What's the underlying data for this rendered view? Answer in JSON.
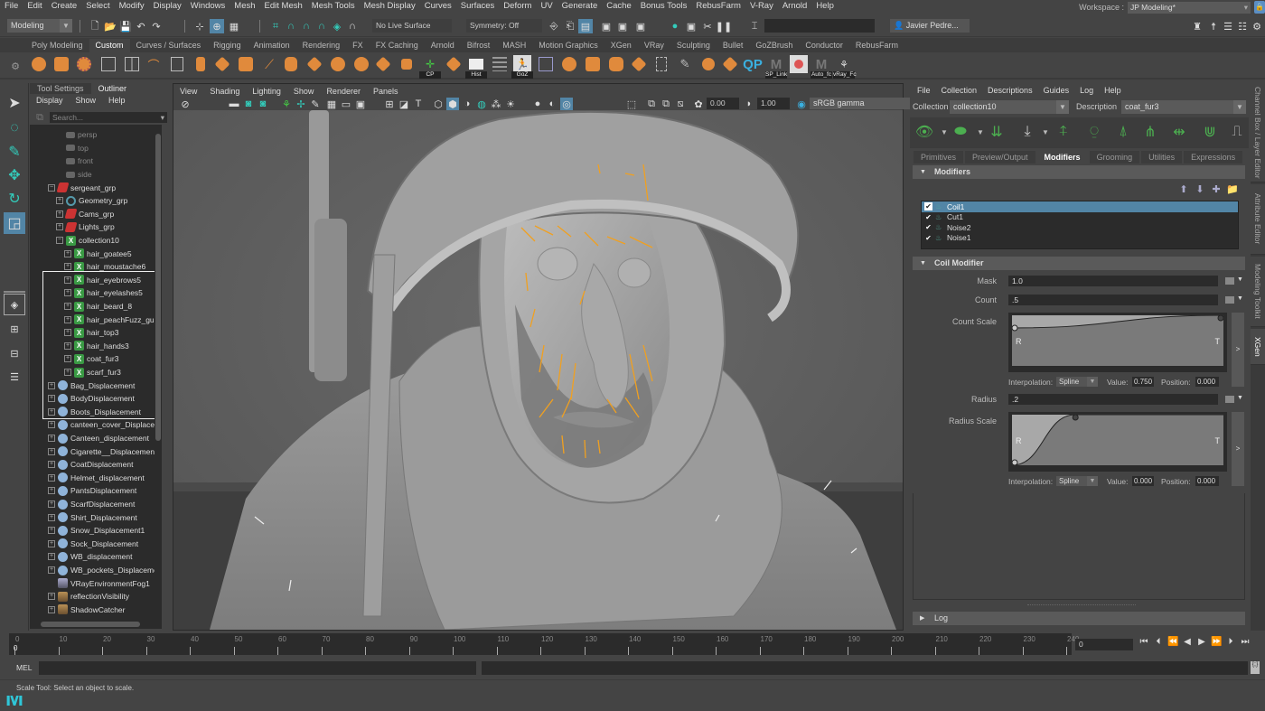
{
  "menubar": {
    "items": [
      "File",
      "Edit",
      "Create",
      "Select",
      "Modify",
      "Display",
      "Windows",
      "Mesh",
      "Edit Mesh",
      "Mesh Tools",
      "Mesh Display",
      "Curves",
      "Surfaces",
      "Deform",
      "UV",
      "Generate",
      "Cache",
      "Bonus Tools",
      "RebusFarm",
      "V-Ray",
      "Arnold",
      "Help"
    ],
    "workspace_label": "Workspace :",
    "workspace_value": "JP Modeling*"
  },
  "statusline": {
    "menuset": "Modeling",
    "live_surface": "No Live Surface",
    "symmetry": "Symmetry: Off",
    "user": "Javier Pedre..."
  },
  "shelf": {
    "tabs": [
      "Poly Modeling",
      "Custom",
      "Curves / Surfaces",
      "Rigging",
      "Animation",
      "Rendering",
      "FX",
      "FX Caching",
      "Arnold",
      "Bifrost",
      "MASH",
      "Motion Graphics",
      "XGen",
      "VRay",
      "Sculpting",
      "Bullet",
      "GoZBrush",
      "Conductor",
      "RebusFarm"
    ],
    "active_tab": "Custom",
    "labels": {
      "cp": "CP",
      "hist": "Hist",
      "goz": "GoZ",
      "qp": "QP",
      "sp_link": "SP_Link",
      "auto_fc": "Auto_fc",
      "vray_fc": "vRay_Fc"
    }
  },
  "outliner": {
    "tabs": [
      "Tool Settings",
      "Outliner"
    ],
    "active_tab": "Outliner",
    "menu": [
      "Display",
      "Show",
      "Help"
    ],
    "search_placeholder": "Search...",
    "rows": [
      {
        "label": "persp",
        "indent": 0,
        "icon": "cam",
        "dim": true
      },
      {
        "label": "top",
        "indent": 0,
        "icon": "cam",
        "dim": true
      },
      {
        "label": "front",
        "indent": 0,
        "icon": "cam",
        "dim": true
      },
      {
        "label": "side",
        "indent": 0,
        "icon": "cam",
        "dim": true
      },
      {
        "label": "sergeant_grp",
        "indent": 0,
        "icon": "grp",
        "exp": "−"
      },
      {
        "label": "Geometry_grp",
        "indent": 1,
        "icon": "geo",
        "exp": "+"
      },
      {
        "label": "Cams_grp",
        "indent": 1,
        "icon": "grp",
        "exp": "+"
      },
      {
        "label": "Lights_grp",
        "indent": 1,
        "icon": "grp",
        "exp": "+"
      },
      {
        "label": "collection10",
        "indent": 1,
        "icon": "xg",
        "exp": "−"
      },
      {
        "label": "hair_goatee5",
        "indent": 2,
        "icon": "xg",
        "exp": "+"
      },
      {
        "label": "hair_moustache6",
        "indent": 2,
        "icon": "xg",
        "exp": "+"
      },
      {
        "label": "hair_eyebrows5",
        "indent": 2,
        "icon": "xg",
        "exp": "+"
      },
      {
        "label": "hair_eyelashes5",
        "indent": 2,
        "icon": "xg",
        "exp": "+"
      },
      {
        "label": "hair_beard_8",
        "indent": 2,
        "icon": "xg",
        "exp": "+"
      },
      {
        "label": "hair_peachFuzz_guide",
        "indent": 2,
        "icon": "xg",
        "exp": "+"
      },
      {
        "label": "hair_top3",
        "indent": 2,
        "icon": "xg",
        "exp": "+"
      },
      {
        "label": "hair_hands3",
        "indent": 2,
        "icon": "xg",
        "exp": "+"
      },
      {
        "label": "coat_fur3",
        "indent": 2,
        "icon": "xg",
        "exp": "+"
      },
      {
        "label": "scarf_fur3",
        "indent": 2,
        "icon": "xg",
        "exp": "+"
      },
      {
        "label": "Bag_Displacement",
        "indent": 0,
        "icon": "disp",
        "exp": "+"
      },
      {
        "label": "BodyDisplacement",
        "indent": 0,
        "icon": "disp",
        "exp": "+"
      },
      {
        "label": "Boots_Displacement",
        "indent": 0,
        "icon": "disp",
        "exp": "+"
      },
      {
        "label": "canteen_cover_Displacement",
        "indent": 0,
        "icon": "disp",
        "exp": "+"
      },
      {
        "label": "Canteen_displacement",
        "indent": 0,
        "icon": "disp",
        "exp": "+"
      },
      {
        "label": "Cigarette__Displacement",
        "indent": 0,
        "icon": "disp",
        "exp": "+"
      },
      {
        "label": "CoatDisplacement",
        "indent": 0,
        "icon": "disp",
        "exp": "+"
      },
      {
        "label": "Helmet_displacement",
        "indent": 0,
        "icon": "disp",
        "exp": "+"
      },
      {
        "label": "PantsDisplacement",
        "indent": 0,
        "icon": "disp",
        "exp": "+"
      },
      {
        "label": "ScarfDisplacement",
        "indent": 0,
        "icon": "disp",
        "exp": "+"
      },
      {
        "label": "Shirt_Displacement",
        "indent": 0,
        "icon": "disp",
        "exp": "+"
      },
      {
        "label": "Snow_Displacement1",
        "indent": 0,
        "icon": "disp",
        "exp": "+"
      },
      {
        "label": "Sock_Displacement",
        "indent": 0,
        "icon": "disp",
        "exp": "+"
      },
      {
        "label": "WB_displacement",
        "indent": 0,
        "icon": "disp",
        "exp": "+"
      },
      {
        "label": "WB_pockets_Displacement",
        "indent": 0,
        "icon": "disp",
        "exp": "+"
      },
      {
        "label": "VRayEnvironmentFog1",
        "indent": 0,
        "icon": "fog"
      },
      {
        "label": "reflectionVisibility",
        "indent": 0,
        "icon": "tex",
        "exp": "+"
      },
      {
        "label": "ShadowCatcher",
        "indent": 0,
        "icon": "tex",
        "exp": "+"
      }
    ]
  },
  "viewport": {
    "menu": [
      "View",
      "Shading",
      "Lighting",
      "Show",
      "Renderer",
      "Panels"
    ],
    "exposure": "0.00",
    "gamma": "1.00",
    "color_space": "sRGB gamma"
  },
  "xgen": {
    "menu": [
      "File",
      "Collection",
      "Descriptions",
      "Guides",
      "Log",
      "Help"
    ],
    "collection_label": "Collection",
    "collection_value": "collection10",
    "description_label": "Description",
    "description_value": "coat_fur3",
    "tabs": [
      "Primitives",
      "Preview/Output",
      "Modifiers",
      "Grooming",
      "Utilities",
      "Expressions"
    ],
    "active_tab": "Modifiers",
    "modifiers_section": "Modifiers",
    "modifiers": [
      {
        "name": "Coil1",
        "checked": true,
        "selected": true
      },
      {
        "name": "Cut1",
        "checked": true,
        "selected": false
      },
      {
        "name": "Noise2",
        "checked": true,
        "selected": false
      },
      {
        "name": "Noise1",
        "checked": true,
        "selected": false
      }
    ],
    "coil_section": "Coil Modifier",
    "mask_label": "Mask",
    "mask_value": "1.0",
    "count_label": "Count",
    "count_value": ".5",
    "count_scale_label": "Count Scale",
    "count_scale": {
      "points": [
        [
          0,
          0.75
        ],
        [
          1,
          1.0
        ]
      ],
      "interpolation": "Spline",
      "value": "0.750",
      "position": "0.000"
    },
    "radius_label": "Radius",
    "radius_value": ".2",
    "radius_scale_label": "Radius Scale",
    "radius_scale": {
      "points": [
        [
          0,
          0
        ],
        [
          0.3,
          1.0
        ]
      ],
      "interpolation": "Spline",
      "value": "0.000",
      "position": "0.000"
    },
    "interp_label": "Interpolation:",
    "value_label": "Value:",
    "position_label": "Position:",
    "ramp_root": "R",
    "ramp_tip": "T",
    "log_section": "Log"
  },
  "sidetabs": [
    "Channel Box / Layer Editor",
    "Attribute Editor",
    "Modeling Toolkit",
    "XGen"
  ],
  "sidetab_active": "XGen",
  "timeslider": {
    "ticks": [
      0,
      10,
      20,
      30,
      40,
      50,
      60,
      70,
      80,
      90,
      100,
      110,
      120,
      130,
      140,
      150,
      160,
      170,
      180,
      190,
      200,
      210,
      220,
      230,
      240
    ],
    "current_frame": "0",
    "current_frame_field": "0"
  },
  "cmdline": {
    "label": "MEL"
  },
  "helpline": {
    "text": "Scale Tool: Select an object to scale."
  }
}
